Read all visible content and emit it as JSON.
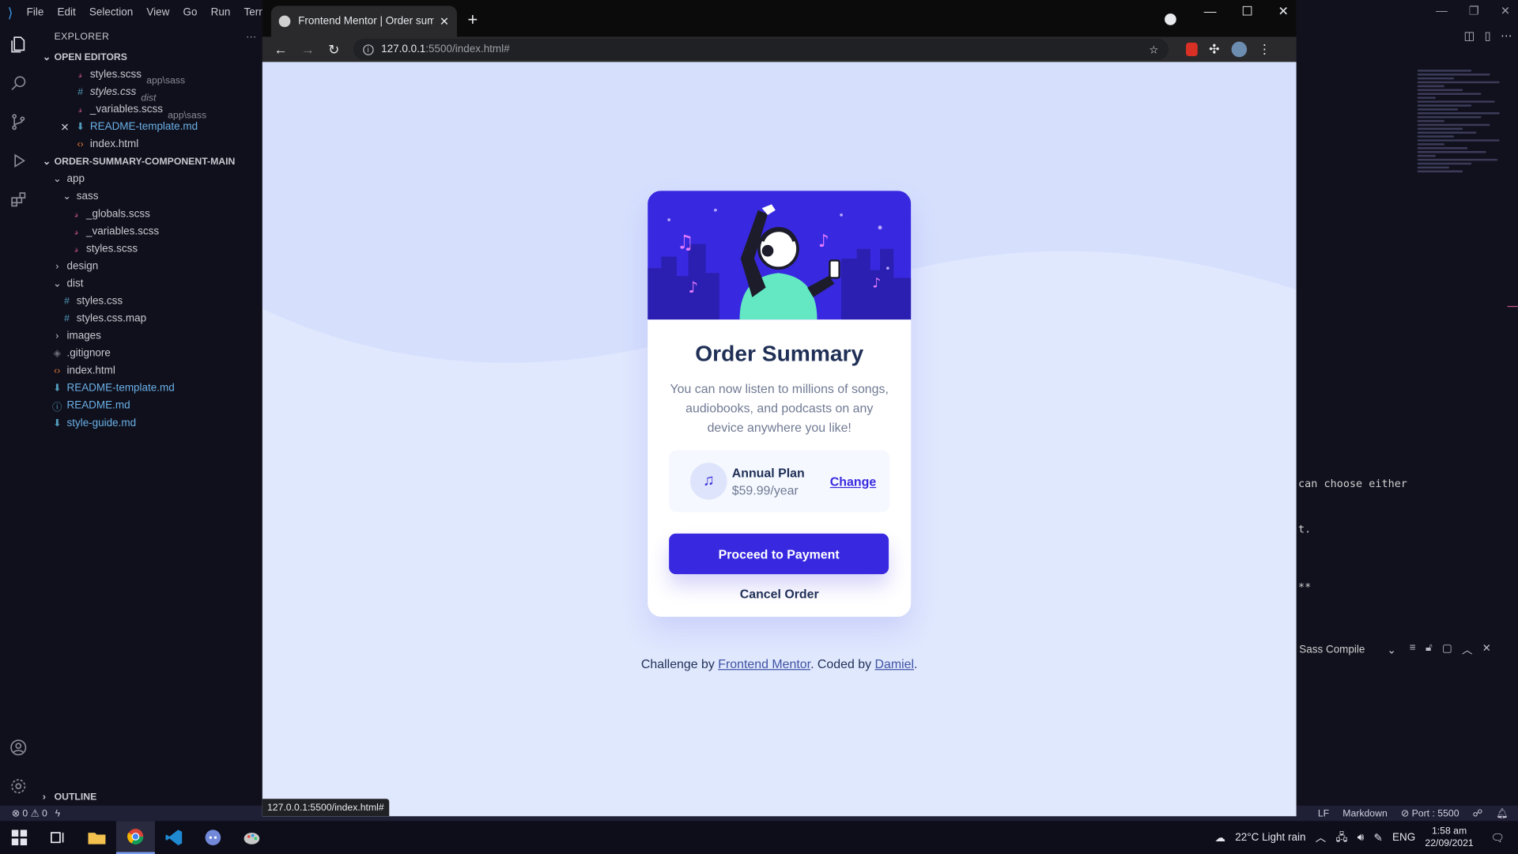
{
  "vscode": {
    "menu": [
      "File",
      "Edit",
      "Selection",
      "View",
      "Go",
      "Run",
      "Termi"
    ],
    "explorer": {
      "title": "EXPLORER",
      "more": "···",
      "open_editors_label": "OPEN EDITORS",
      "open_editors": [
        {
          "name": "styles.scss",
          "desc": "app\\sass",
          "icon": "sass-icon"
        },
        {
          "name": "styles.css",
          "desc": "dist",
          "icon": "css-icon"
        },
        {
          "name": "_variables.scss",
          "desc": "app\\sass",
          "icon": "sass-icon"
        },
        {
          "name": "README-template.md",
          "desc": "",
          "icon": "markdown-icon"
        },
        {
          "name": "index.html",
          "desc": "",
          "icon": "html-icon"
        }
      ],
      "project_label": "ORDER-SUMMARY-COMPONENT-MAIN",
      "tree": [
        {
          "name": "app",
          "depth": 0,
          "kind": "folder-open"
        },
        {
          "name": "sass",
          "depth": 1,
          "kind": "folder-open"
        },
        {
          "name": "_globals.scss",
          "depth": 2,
          "kind": "sass"
        },
        {
          "name": "_variables.scss",
          "depth": 2,
          "kind": "sass"
        },
        {
          "name": "styles.scss",
          "depth": 2,
          "kind": "sass"
        },
        {
          "name": "design",
          "depth": 0,
          "kind": "folder"
        },
        {
          "name": "dist",
          "depth": 0,
          "kind": "folder-open"
        },
        {
          "name": "styles.css",
          "depth": 1,
          "kind": "css"
        },
        {
          "name": "styles.css.map",
          "depth": 1,
          "kind": "css"
        },
        {
          "name": "images",
          "depth": 0,
          "kind": "folder"
        },
        {
          "name": ".gitignore",
          "depth": 0,
          "kind": "git"
        },
        {
          "name": "index.html",
          "depth": 0,
          "kind": "html"
        },
        {
          "name": "README-template.md",
          "depth": 0,
          "kind": "md"
        },
        {
          "name": "README.md",
          "depth": 0,
          "kind": "info"
        },
        {
          "name": "style-guide.md",
          "depth": 0,
          "kind": "md"
        }
      ],
      "outline_label": "OUTLINE"
    },
    "terminal_lines": [
      "can choose either",
      "t.",
      "**"
    ],
    "panel_select": "Sass Compile",
    "status": {
      "errors": "0",
      "warnings": "0",
      "eol": "LF",
      "language": "Markdown",
      "port": "Port : 5500"
    }
  },
  "chrome": {
    "tab_title": "Frontend Mentor | Order summa",
    "url_host": "127.0.0.1",
    "url_path": ":5500/index.html#",
    "status_url": "127.0.0.1:5500/index.html#"
  },
  "page": {
    "title": "Order Summary",
    "description": "You can now listen to millions of songs, audiobooks, and podcasts on any device anywhere you like!",
    "plan_name": "Annual Plan",
    "plan_price": "$59.99/year",
    "change_label": "Change",
    "pay_label": "Proceed to Payment",
    "cancel_label": "Cancel Order",
    "attribution": {
      "prefix": "Challenge by ",
      "link1": "Frontend Mentor",
      "middle": ". Coded by ",
      "link2": "Damiel",
      "suffix": "."
    },
    "colors": {
      "primary": "#3829e0",
      "background": "#e0e8fe",
      "title": "#1f2f56"
    }
  },
  "taskbar": {
    "weather": "22°C  Light rain",
    "lang": "ENG",
    "time": "1:58 am",
    "date": "22/09/2021"
  }
}
